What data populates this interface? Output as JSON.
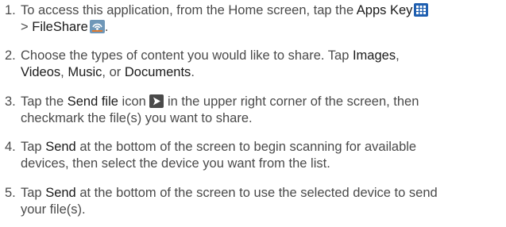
{
  "steps": [
    {
      "number": "1.",
      "line1": {
        "t1": "To access this application, from the Home screen, tap the ",
        "t2": "Apps Key"
      },
      "line2": {
        "t1": "> ",
        "t2": "FileShare"
      },
      "icons": {
        "apps": "apps-grid-icon",
        "fileshare": "fileshare-icon"
      }
    },
    {
      "number": "2.",
      "line1": {
        "t1": "Choose the types of content you would like to share. Tap ",
        "t2": "Images",
        "t3": ","
      },
      "line2": {
        "t1": "Videos",
        "t2": ", ",
        "t3": "Music",
        "t4": ", or ",
        "t5": "Documents",
        "t6": "."
      }
    },
    {
      "number": "3.",
      "line1": {
        "t1": "Tap the ",
        "t2": "Send file",
        "t3": " icon ",
        "t4": " in the upper right corner of the screen, then"
      },
      "line2": "checkmark the file(s) you want to share.",
      "icons": {
        "send": "send-arrow-icon"
      }
    },
    {
      "number": "4.",
      "line1": {
        "t1": "Tap ",
        "t2": "Send",
        "t3": " at the bottom of the screen to begin scanning for available"
      },
      "line2": "devices, then select the device you want from the list."
    },
    {
      "number": "5.",
      "line1": {
        "t1": "Tap ",
        "t2": "Send",
        "t3": " at the bottom of the screen to use the selected device to send"
      },
      "line2": "your file(s)."
    }
  ],
  "colors": {
    "text": "#4a4a4a",
    "highlight": "#1a1a1a",
    "apps_icon": "#1f5fb0",
    "send_icon": "#4a4a4a"
  }
}
